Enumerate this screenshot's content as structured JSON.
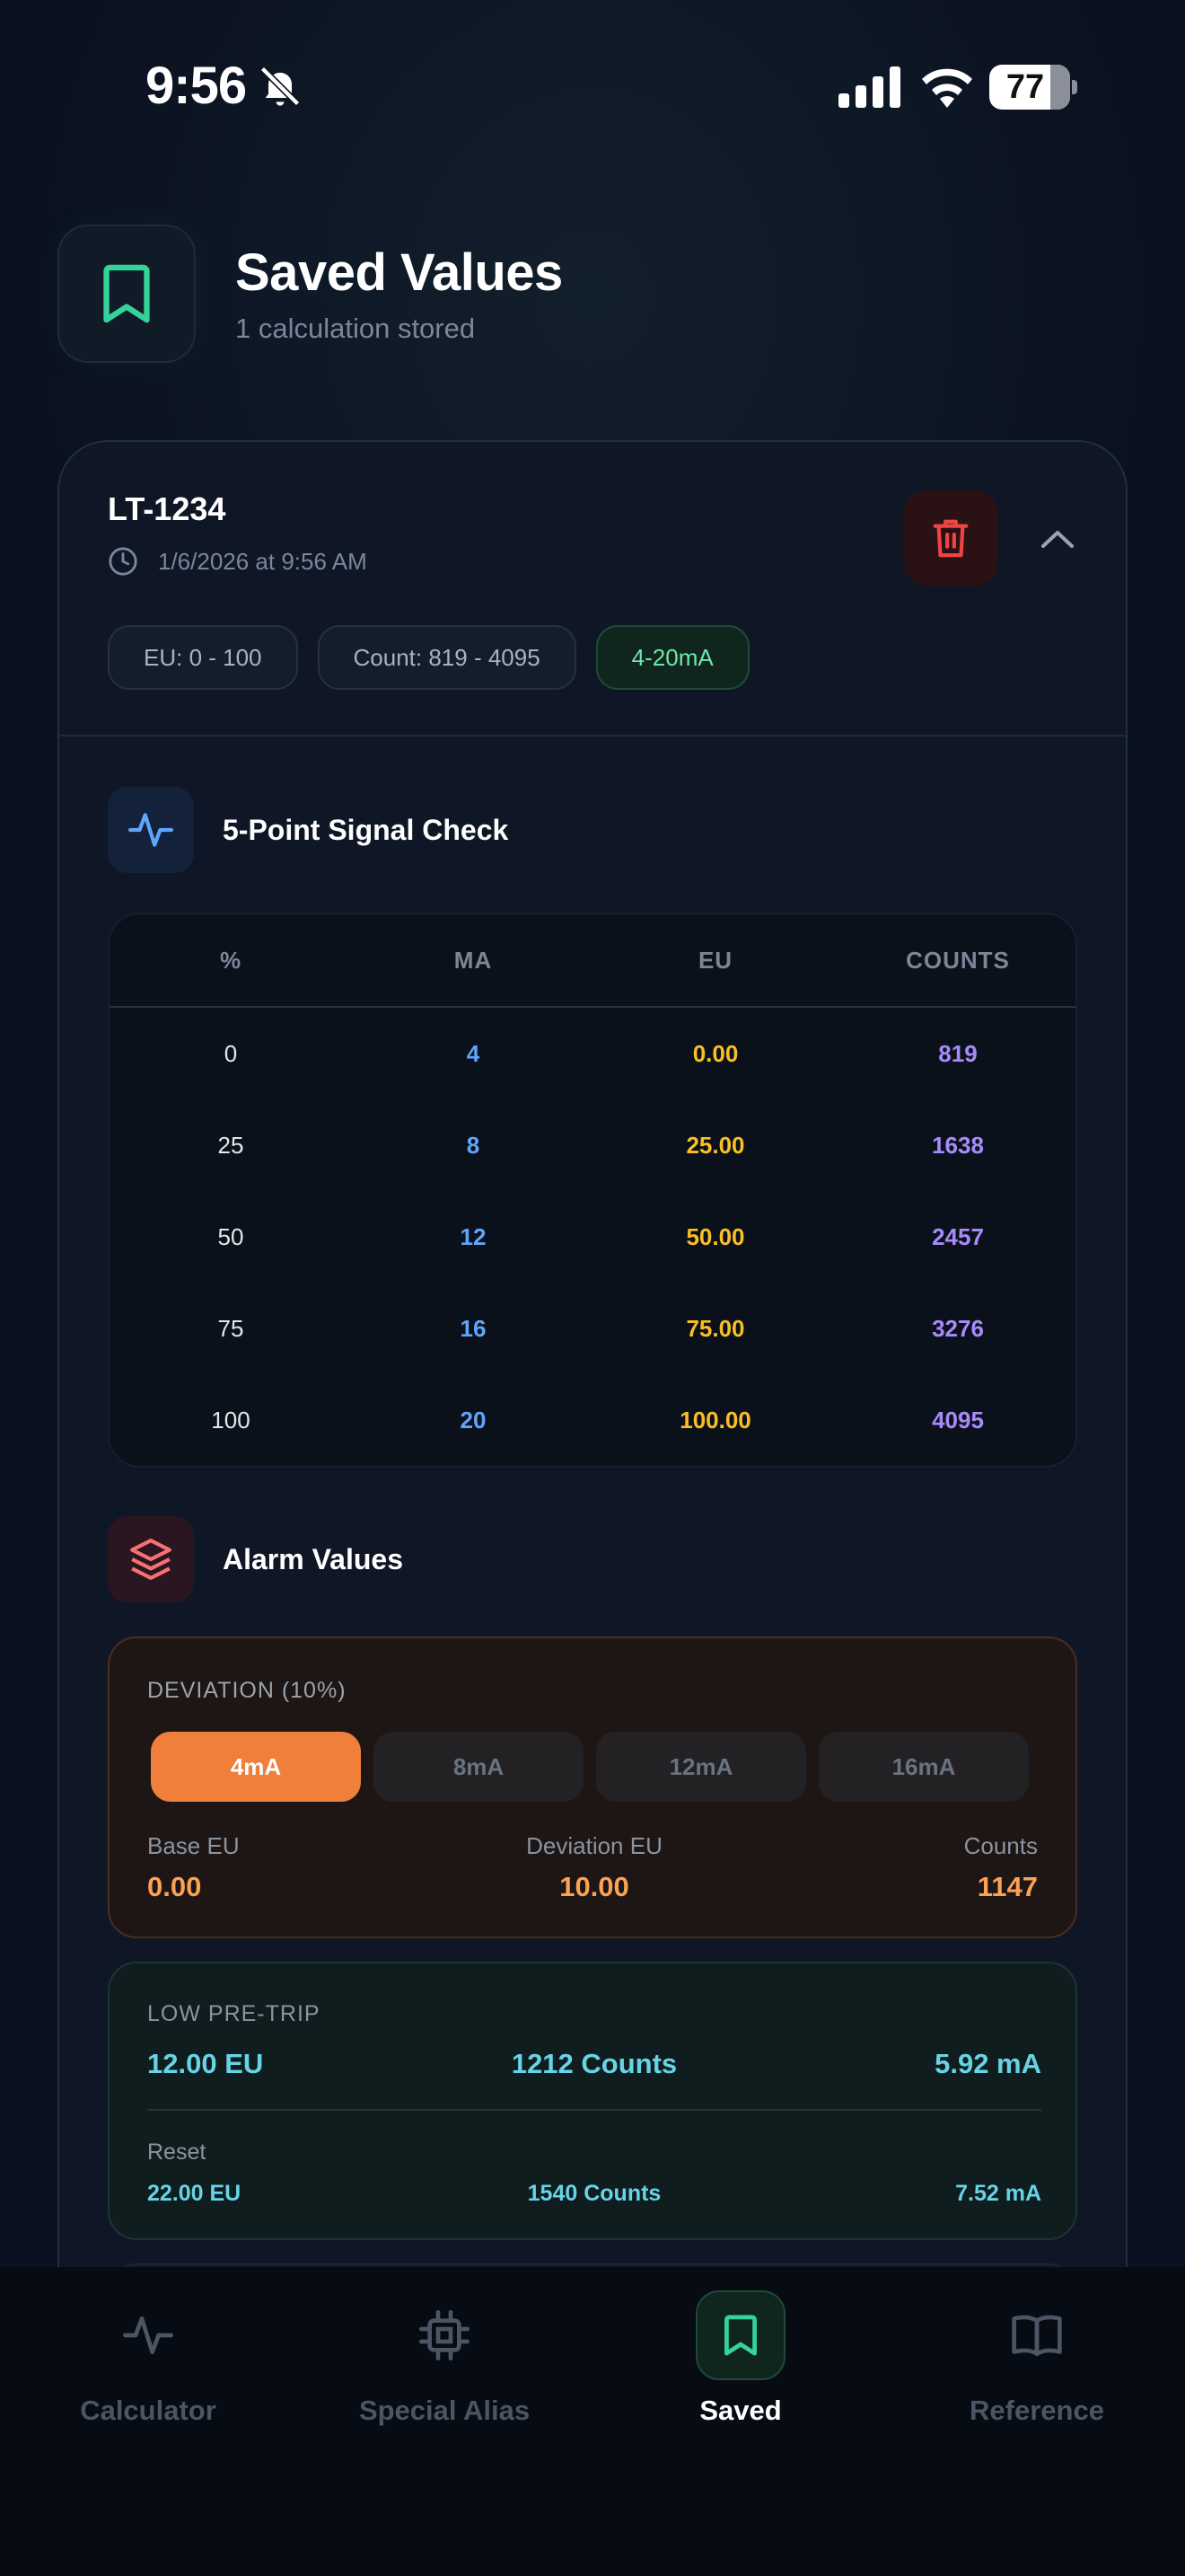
{
  "status_bar": {
    "time": "9:56",
    "battery": "77"
  },
  "header": {
    "title": "Saved Values",
    "subtitle": "1 calculation stored"
  },
  "saved_item": {
    "tag": "LT-1234",
    "timestamp": "1/6/2026 at 9:56 AM",
    "chips": [
      "EU: 0 - 100",
      "Count: 819 - 4095",
      "4-20mA"
    ]
  },
  "signal_check": {
    "title": "5-Point Signal Check",
    "columns": [
      "%",
      "MA",
      "EU",
      "COUNTS"
    ],
    "rows": [
      {
        "pct": "0",
        "ma": "4",
        "eu": "0.00",
        "counts": "819"
      },
      {
        "pct": "25",
        "ma": "8",
        "eu": "25.00",
        "counts": "1638"
      },
      {
        "pct": "50",
        "ma": "12",
        "eu": "50.00",
        "counts": "2457"
      },
      {
        "pct": "75",
        "ma": "16",
        "eu": "75.00",
        "counts": "3276"
      },
      {
        "pct": "100",
        "ma": "20",
        "eu": "100.00",
        "counts": "4095"
      }
    ]
  },
  "alarm_values": {
    "title": "Alarm Values",
    "deviation": {
      "label": "DEVIATION (10%)",
      "tabs": [
        "4mA",
        "8mA",
        "12mA",
        "16mA"
      ],
      "selected_tab": "4mA",
      "base_eu_label": "Base EU",
      "base_eu": "0.00",
      "deviation_eu_label": "Deviation EU",
      "deviation_eu": "10.00",
      "counts_label": "Counts",
      "counts": "1147"
    },
    "low_pre_trip": {
      "label": "LOW PRE-TRIP",
      "eu": "12.00 EU",
      "counts": "1212 Counts",
      "ma": "5.92 mA",
      "reset_label": "Reset",
      "reset_eu": "22.00 EU",
      "reset_counts": "1540 Counts",
      "reset_ma": "7.52 mA"
    }
  },
  "tab_bar": {
    "tabs": [
      "Calculator",
      "Special Alias",
      "Saved",
      "Reference"
    ],
    "active": "Saved"
  },
  "colors": {
    "accent_green": "#34d399",
    "accent_orange": "#ef7f3a",
    "ma_blue": "#60a5fa",
    "eu_yellow": "#fbbf24",
    "counts_purple": "#a78bfa",
    "danger_red": "#ef4444"
  }
}
